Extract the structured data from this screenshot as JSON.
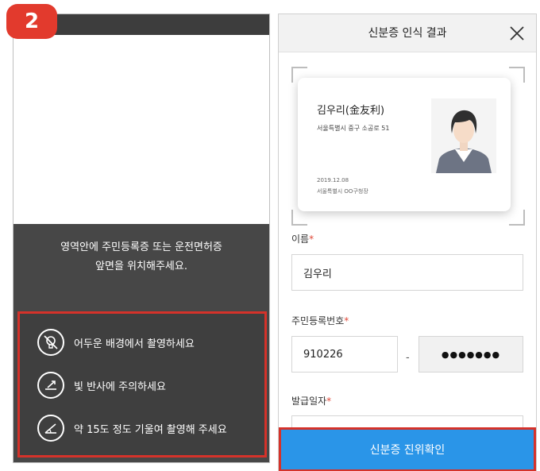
{
  "step": {
    "number": "2"
  },
  "left_phone": {
    "guide_line1": "영역안에 주민등록증 또는 운전면허증",
    "guide_line2": "앞면을 위치해주세요.",
    "tips": [
      {
        "icon": "no-flash-icon",
        "text": "어두운 배경에서 촬영하세요"
      },
      {
        "icon": "reflection-icon",
        "text": "빛 반사에 주의하세요"
      },
      {
        "icon": "tilt-angle-icon",
        "text": "약 15도 정도 기울여 촬영해 주세요"
      }
    ]
  },
  "right_phone": {
    "title": "신분증 인식 결과",
    "card": {
      "name": "김우리(金友利)",
      "address": "서울특별시 중구 소공로 51",
      "date": "2019.12.08",
      "issuer": "서울특별시 OO구청장"
    },
    "fields": {
      "name_label": "이름",
      "name_value": "김우리",
      "rrn_label": "주민등록번호",
      "rrn_front": "910226",
      "rrn_separator": "-",
      "rrn_back_masked": "●●●●●●●",
      "issue_date_label": "발급일자",
      "required_mark": "*"
    },
    "confirm_button": "신분증 진위확인"
  },
  "colors": {
    "highlight": "#d5322a",
    "primary_button": "#2a95e8",
    "badge": "#e23a2d",
    "dark_panel": "#474747"
  }
}
